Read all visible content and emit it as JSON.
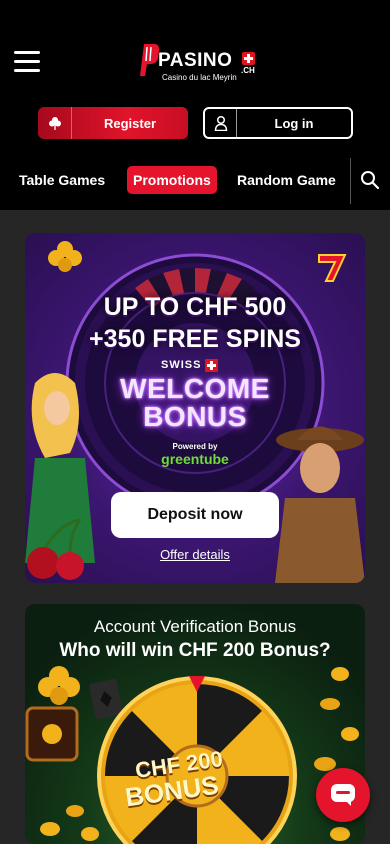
{
  "header": {
    "logo_text": "PASINO",
    "logo_tld": ".CH",
    "logo_subtitle": "Casino du lac Meyrin",
    "register_label": "Register",
    "login_label": "Log in"
  },
  "nav": {
    "items": [
      {
        "label": "Table Games",
        "active": false
      },
      {
        "label": "Promotions",
        "active": true
      },
      {
        "label": "Random Game",
        "active": false
      }
    ]
  },
  "promo": {
    "headline1": "UP TO CHF 500",
    "headline2": "+350 FREE SPINS",
    "swiss_label": "SWISS",
    "welcome_line1": "WELCOME",
    "welcome_line2": "BONUS",
    "powered_by": "Powered by",
    "provider": "greentube",
    "cta_label": "Deposit now",
    "details_link": "Offer details"
  },
  "verification": {
    "title": "Account Verification Bonus",
    "subtitle": "Who will win CHF 200 Bonus?",
    "wheel_text_line1": "CHF 200",
    "wheel_text_line2": "BONUS"
  },
  "colors": {
    "brand_red": "#e3142b",
    "background": "#262626",
    "header_bg": "#000000"
  }
}
